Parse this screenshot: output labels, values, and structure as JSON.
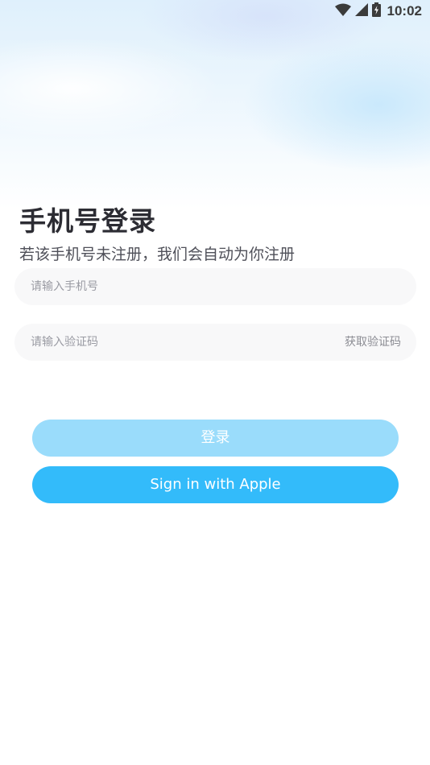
{
  "status_bar": {
    "time": "10:02",
    "wifi_icon": "wifi-icon",
    "signal_icon": "signal-icon",
    "battery_icon": "battery-charging-icon"
  },
  "login": {
    "title": "手机号登录",
    "subtitle": "若该手机号未注册，我们会自动为你注册",
    "phone_placeholder": "请输入手机号",
    "phone_value": "",
    "code_placeholder": "请输入验证码",
    "code_value": "",
    "get_code_label": "获取验证码",
    "login_button": "登录",
    "apple_button": "Sign in with Apple"
  },
  "colors": {
    "login_button_bg": "#9adcfb",
    "apple_button_bg": "#33bbfa",
    "title_text": "#2c2c33",
    "input_bg": "#f8f8f9"
  }
}
